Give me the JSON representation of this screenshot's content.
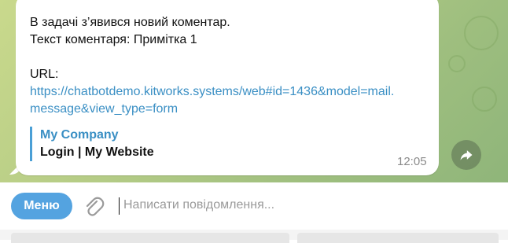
{
  "message": {
    "line1": "В задачі з’явився новий коментар.",
    "line2": "Текст коментаря: Примітка 1",
    "url_label": "URL:",
    "url_part1": "https://chatbotdemo.kitworks.systems/web#id=1436&model=mail.",
    "url_part2": "message&view_type=form",
    "preview_site": "My Company",
    "preview_title": "Login | My Website",
    "time": "12:05"
  },
  "composer": {
    "menu_label": "Меню",
    "placeholder": "Написати повідомлення..."
  },
  "icons": {
    "share": "share-arrow-icon",
    "attach": "paperclip-icon"
  },
  "colors": {
    "accent": "#54a3e0",
    "link": "#3a8fc4",
    "chat_bg": "#b5cc86"
  }
}
